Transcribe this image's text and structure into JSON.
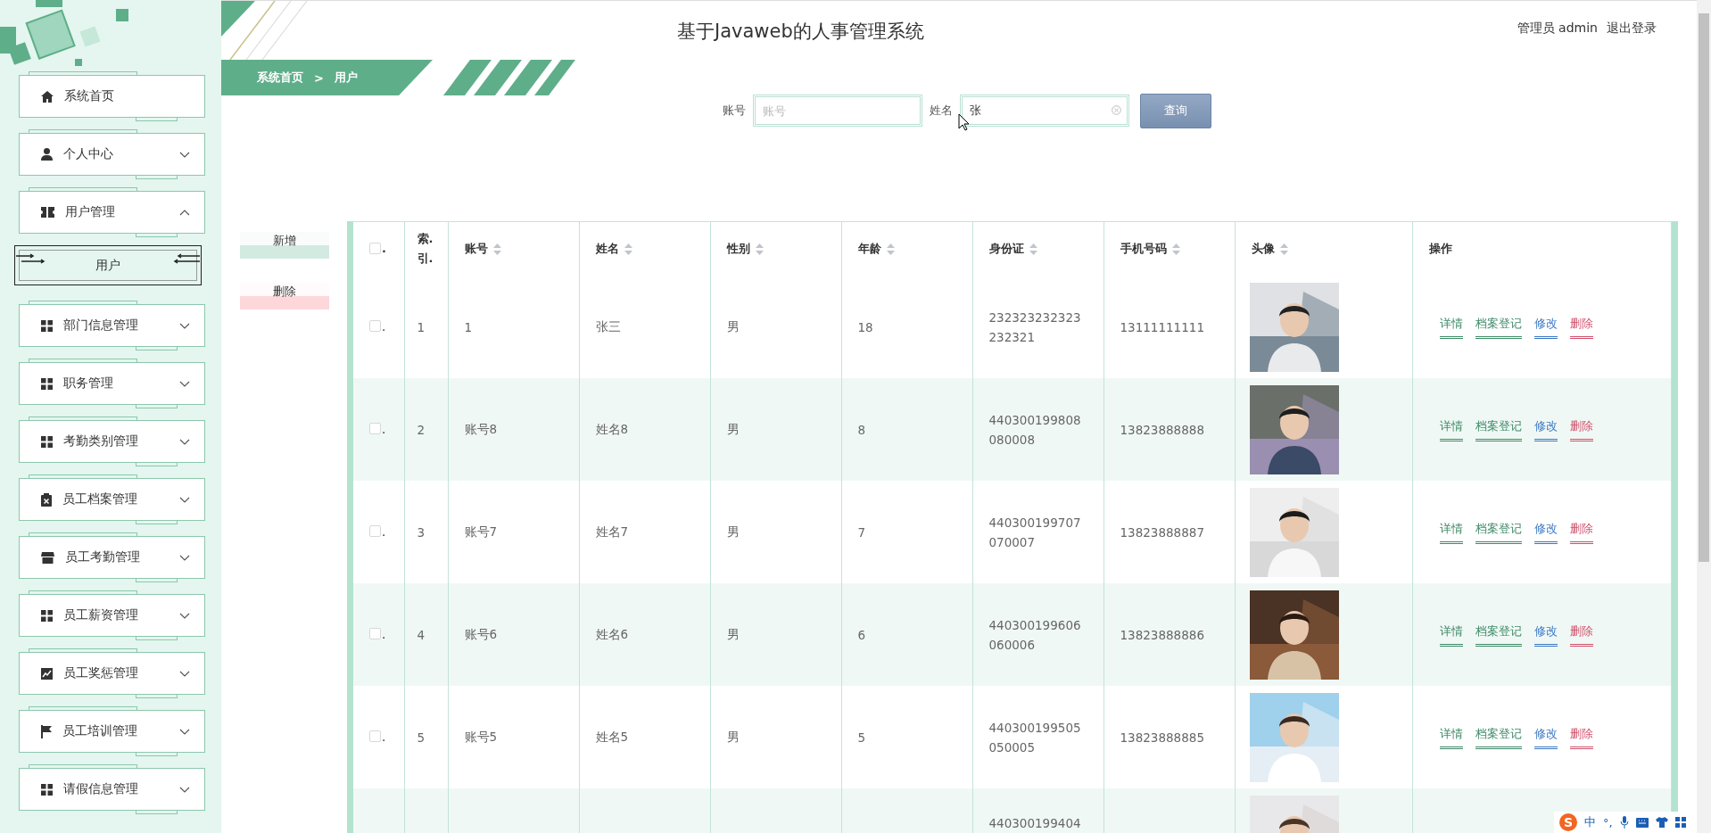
{
  "header": {
    "title": "基于Javaweb的人事管理系统",
    "user": "管理员 admin",
    "logout": "退出登录"
  },
  "breadcrumb": [
    "系统首页",
    ">",
    "用户"
  ],
  "sidebar": {
    "items": [
      {
        "label": "系统首页",
        "kind": "home"
      },
      {
        "label": "个人中心",
        "kind": "user",
        "expanded": false
      },
      {
        "label": "用户管理",
        "kind": "ticket",
        "expanded": true,
        "children": [
          {
            "label": "用户",
            "selected": true
          }
        ]
      },
      {
        "label": "部门信息管理",
        "kind": "grid",
        "expanded": false
      },
      {
        "label": "职务管理",
        "kind": "grid",
        "expanded": false
      },
      {
        "label": "考勤类别管理",
        "kind": "grid",
        "expanded": false
      },
      {
        "label": "员工档案管理",
        "kind": "clipboard",
        "expanded": false
      },
      {
        "label": "员工考勤管理",
        "kind": "store",
        "expanded": false
      },
      {
        "label": "员工薪资管理",
        "kind": "grid",
        "expanded": false
      },
      {
        "label": "员工奖惩管理",
        "kind": "chart",
        "expanded": false
      },
      {
        "label": "员工培训管理",
        "kind": "flag",
        "expanded": false
      },
      {
        "label": "请假信息管理",
        "kind": "grid",
        "expanded": false
      }
    ]
  },
  "search": {
    "fields": [
      {
        "label": "账号",
        "placeholder": "账号"
      },
      {
        "label": "姓名",
        "value": "张"
      }
    ],
    "button": "查询"
  },
  "actions": [
    {
      "label": "新增",
      "kind": "add"
    },
    {
      "label": "删除",
      "kind": "delete"
    }
  ],
  "table": {
    "header_checkbox": {
      "label": ".",
      "checked": false
    },
    "columns": [
      {
        "label": "索.引.",
        "sortable": false
      },
      {
        "label": "账号",
        "sortable": true
      },
      {
        "label": "姓名",
        "sortable": true
      },
      {
        "label": "性别",
        "sortable": true
      },
      {
        "label": "年龄",
        "sortable": true
      },
      {
        "label": "身份证",
        "sortable": true
      },
      {
        "label": "手机号码",
        "sortable": true
      },
      {
        "label": "头像",
        "sortable": true
      },
      {
        "label": "操作",
        "sortable": false
      }
    ],
    "rows": [
      {
        "checkbox_label": ".",
        "checked": false,
        "cells": [
          "1",
          "1",
          "张三",
          "男",
          "18",
          "232323232323232321",
          "13111111111"
        ],
        "actions": [
          {
            "label": "详情",
            "color": "#3f8a68"
          },
          {
            "label": "档案登记",
            "color": "#3f8a68"
          },
          {
            "label": "修改",
            "color": "#3b78c4"
          },
          {
            "label": "删除",
            "color": "#d0506b"
          }
        ]
      },
      {
        "checkbox_label": ".",
        "checked": false,
        "cells": [
          "2",
          "账号8",
          "姓名8",
          "男",
          "8",
          "440300199808080008",
          "13823888888"
        ],
        "actions": [
          {
            "label": "详情",
            "color": "#3f8a68"
          },
          {
            "label": "档案登记",
            "color": "#3f8a68"
          },
          {
            "label": "修改",
            "color": "#3b78c4"
          },
          {
            "label": "删除",
            "color": "#d0506b"
          }
        ]
      },
      {
        "checkbox_label": ".",
        "checked": false,
        "cells": [
          "3",
          "账号7",
          "姓名7",
          "男",
          "7",
          "440300199707070007",
          "13823888887"
        ],
        "actions": [
          {
            "label": "详情",
            "color": "#3f8a68"
          },
          {
            "label": "档案登记",
            "color": "#3f8a68"
          },
          {
            "label": "修改",
            "color": "#3b78c4"
          },
          {
            "label": "删除",
            "color": "#d0506b"
          }
        ]
      },
      {
        "checkbox_label": ".",
        "checked": false,
        "cells": [
          "4",
          "账号6",
          "姓名6",
          "男",
          "6",
          "440300199606060006",
          "13823888886"
        ],
        "actions": [
          {
            "label": "详情",
            "color": "#3f8a68"
          },
          {
            "label": "档案登记",
            "color": "#3f8a68"
          },
          {
            "label": "修改",
            "color": "#3b78c4"
          },
          {
            "label": "删除",
            "color": "#d0506b"
          }
        ]
      },
      {
        "checkbox_label": ".",
        "checked": false,
        "cells": [
          "5",
          "账号5",
          "姓名5",
          "男",
          "5",
          "440300199505050005",
          "13823888885"
        ],
        "actions": [
          {
            "label": "详情",
            "color": "#3f8a68"
          },
          {
            "label": "档案登记",
            "color": "#3f8a68"
          },
          {
            "label": "修改",
            "color": "#3b78c4"
          },
          {
            "label": "删除",
            "color": "#d0506b"
          }
        ]
      },
      {
        "kind": "partial",
        "id_card": "440300199404"
      }
    ]
  },
  "ime_bar": {
    "logo": "S",
    "mode": "中",
    "punct": "°,"
  }
}
